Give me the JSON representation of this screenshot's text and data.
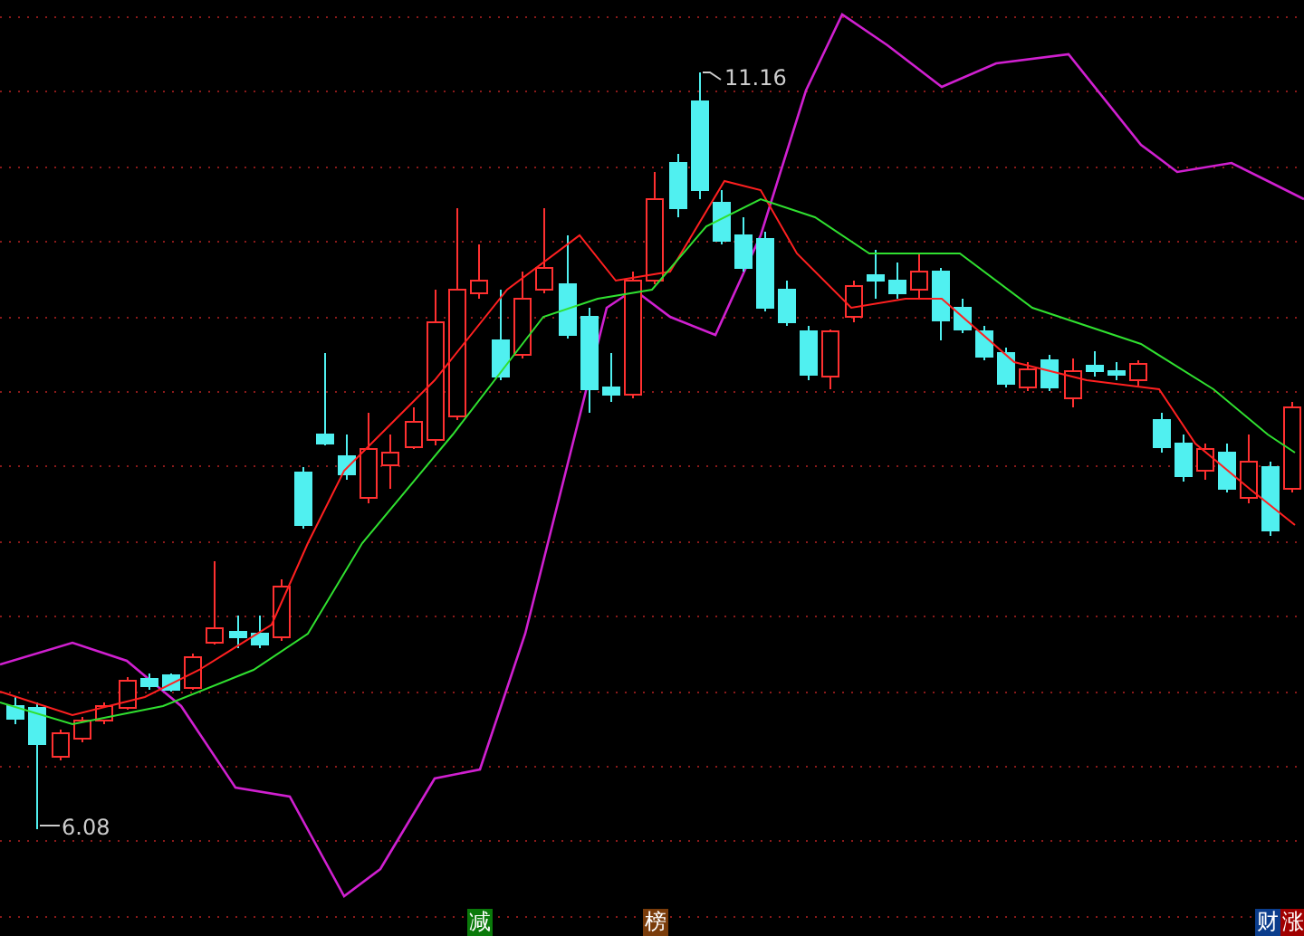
{
  "chart": {
    "high_label": "11.16",
    "low_label": "6.08"
  },
  "markers": [
    {
      "label": "减",
      "color": "#0a7a0a"
    },
    {
      "label": "榜",
      "color": "#7a3c0a"
    },
    {
      "label": "财",
      "color": "#0b3d8c"
    },
    {
      "label": "涨",
      "color": "#a00000"
    }
  ]
}
